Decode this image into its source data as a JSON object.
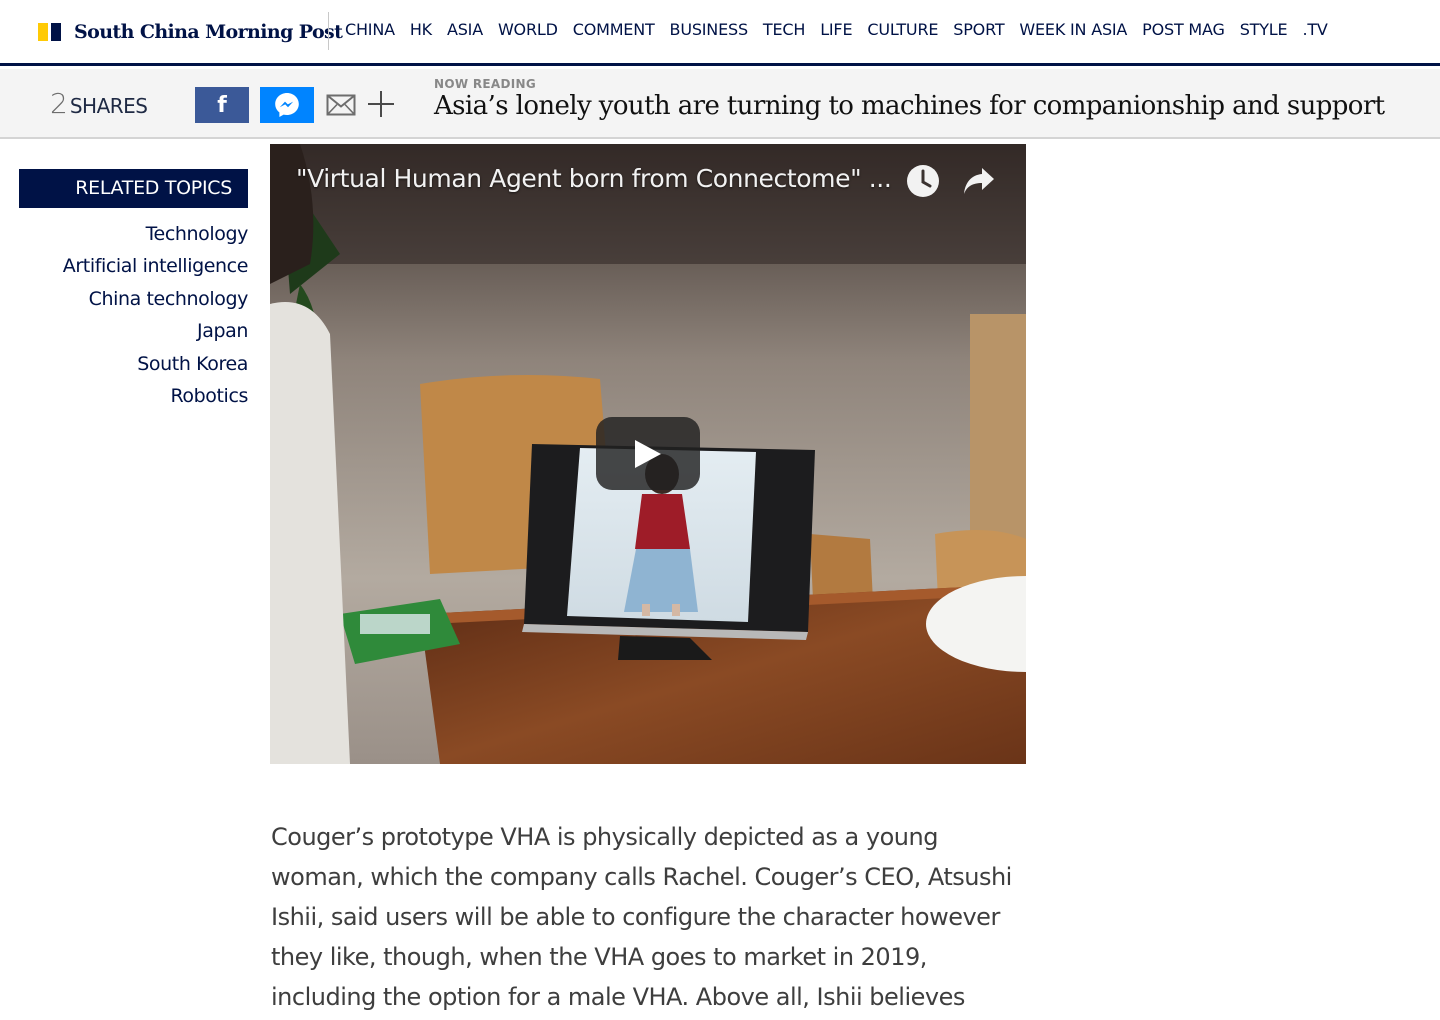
{
  "brand": {
    "name": "South China Morning Post",
    "colors": {
      "navy": "#001246",
      "yellow": "#ffca05"
    }
  },
  "nav": {
    "items": [
      "CHINA",
      "HK",
      "ASIA",
      "WORLD",
      "COMMENT",
      "BUSINESS",
      "TECH",
      "LIFE",
      "CULTURE",
      "SPORT",
      "WEEK IN ASIA",
      "POST MAG",
      "STYLE",
      ".TV"
    ]
  },
  "reading_bar": {
    "shares_count": "2",
    "shares_label": "SHARES",
    "share_buttons": [
      "facebook-icon",
      "messenger-icon",
      "mail-icon",
      "plus-icon"
    ],
    "now_reading_label": "NOW READING",
    "title": "Asia’s lonely youth are turning to machines for companionship and support"
  },
  "related": {
    "heading": "RELATED TOPICS",
    "topics": [
      "Technology",
      "Artificial intelligence",
      "China technology",
      "Japan",
      "South Korea",
      "Robotics"
    ]
  },
  "video": {
    "title": "\"Virtual Human Agent born from Connectome\" ...",
    "icons": [
      "clock-icon",
      "share-arrow-icon",
      "play-icon"
    ]
  },
  "article": {
    "paragraph_lines": [
      "Couger’s prototype VHA is physically depicted as a young",
      "woman, which the company calls Rachel. Couger’s CEO, Atsushi",
      "Ishii, said users will be able to configure the character however",
      "they like, though, when the VHA goes to market in 2019,",
      "including the option for a male VHA. Above all, Ishii believes"
    ]
  }
}
